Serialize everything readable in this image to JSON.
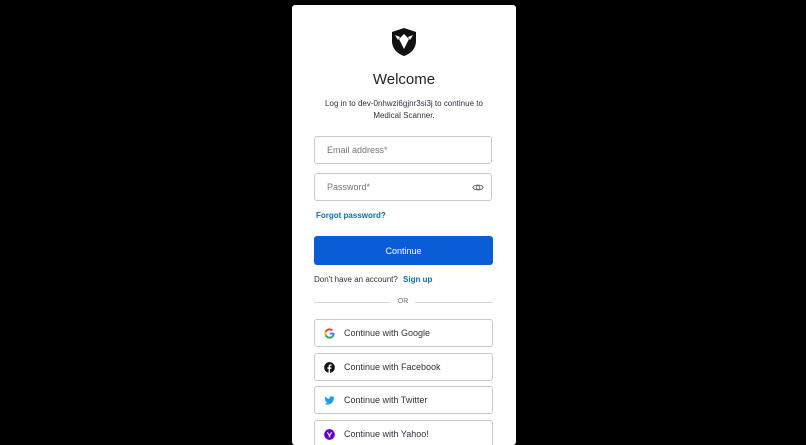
{
  "login": {
    "title": "Welcome",
    "subtitle": "Log in to dev-0nhwzi6gjnr3si3j to continue to Medical Scanner.",
    "email_placeholder": "Email address*",
    "password_placeholder": "Password*",
    "forgot_password": "Forgot password?",
    "continue_label": "Continue",
    "no_account_text": "Don't have an account?",
    "signup_label": "Sign up",
    "divider_text": "OR"
  },
  "social": {
    "google": "Continue with Google",
    "facebook": "Continue with Facebook",
    "twitter": "Continue with Twitter",
    "yahoo": "Continue with Yahoo!"
  },
  "colors": {
    "primary": "#0a5dd6",
    "link": "#0a6fb5",
    "background": "#000000",
    "facebook": "#1877f2",
    "twitter": "#1d9bf0",
    "yahoo": "#6001d2"
  },
  "icons": {
    "logo": "shield-logo-icon",
    "password_toggle": "eye-icon",
    "google": "google-icon",
    "facebook": "facebook-icon",
    "twitter": "twitter-icon",
    "yahoo": "yahoo-icon"
  }
}
